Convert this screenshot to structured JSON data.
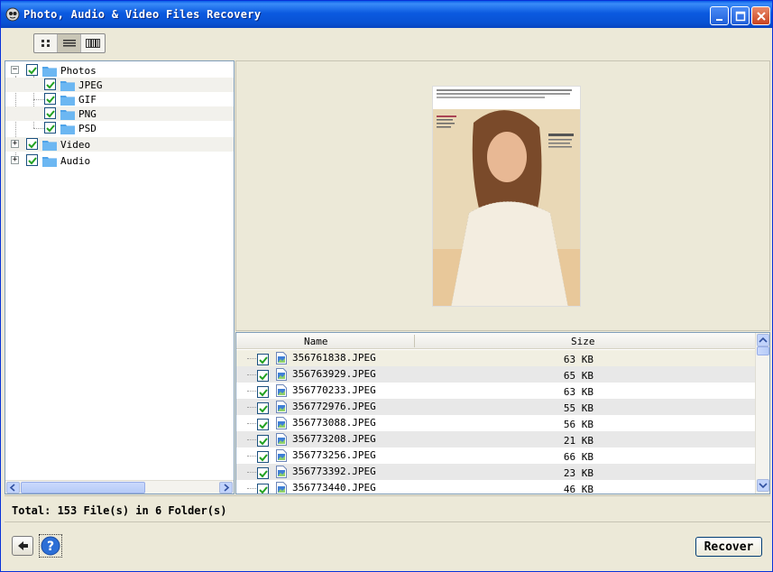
{
  "window": {
    "title": "Photo, Audio & Video Files Recovery"
  },
  "toolbar": {
    "views": [
      "thumbnails",
      "list",
      "filmstrip"
    ],
    "active_view": "list"
  },
  "tree": {
    "items": [
      {
        "label": "Photos",
        "checked": true,
        "expanded": true
      },
      {
        "label": "JPEG",
        "checked": true,
        "selected": true
      },
      {
        "label": "GIF",
        "checked": true
      },
      {
        "label": "PNG",
        "checked": true
      },
      {
        "label": "PSD",
        "checked": true
      },
      {
        "label": "Video",
        "checked": true,
        "expanded": false
      },
      {
        "label": "Audio",
        "checked": true,
        "expanded": false
      }
    ]
  },
  "list": {
    "columns": {
      "name": "Name",
      "size": "Size"
    },
    "rows": [
      {
        "name": "356761838.JPEG",
        "size": "63 KB"
      },
      {
        "name": "356763929.JPEG",
        "size": "65 KB"
      },
      {
        "name": "356770233.JPEG",
        "size": "63 KB"
      },
      {
        "name": "356772976.JPEG",
        "size": "55 KB"
      },
      {
        "name": "356773088.JPEG",
        "size": "56 KB"
      },
      {
        "name": "356773208.JPEG",
        "size": "21 KB"
      },
      {
        "name": "356773256.JPEG",
        "size": "66 KB"
      },
      {
        "name": "356773392.JPEG",
        "size": "23 KB"
      },
      {
        "name": "356773440.JPEG",
        "size": "46 KB"
      }
    ]
  },
  "status": {
    "text": "Total: 153 File(s) in 6 Folder(s)"
  },
  "buttons": {
    "recover": "Recover"
  },
  "colors": {
    "titlebar": "#0852d4",
    "check": "#21a121",
    "folder": "#4fa3e8"
  }
}
